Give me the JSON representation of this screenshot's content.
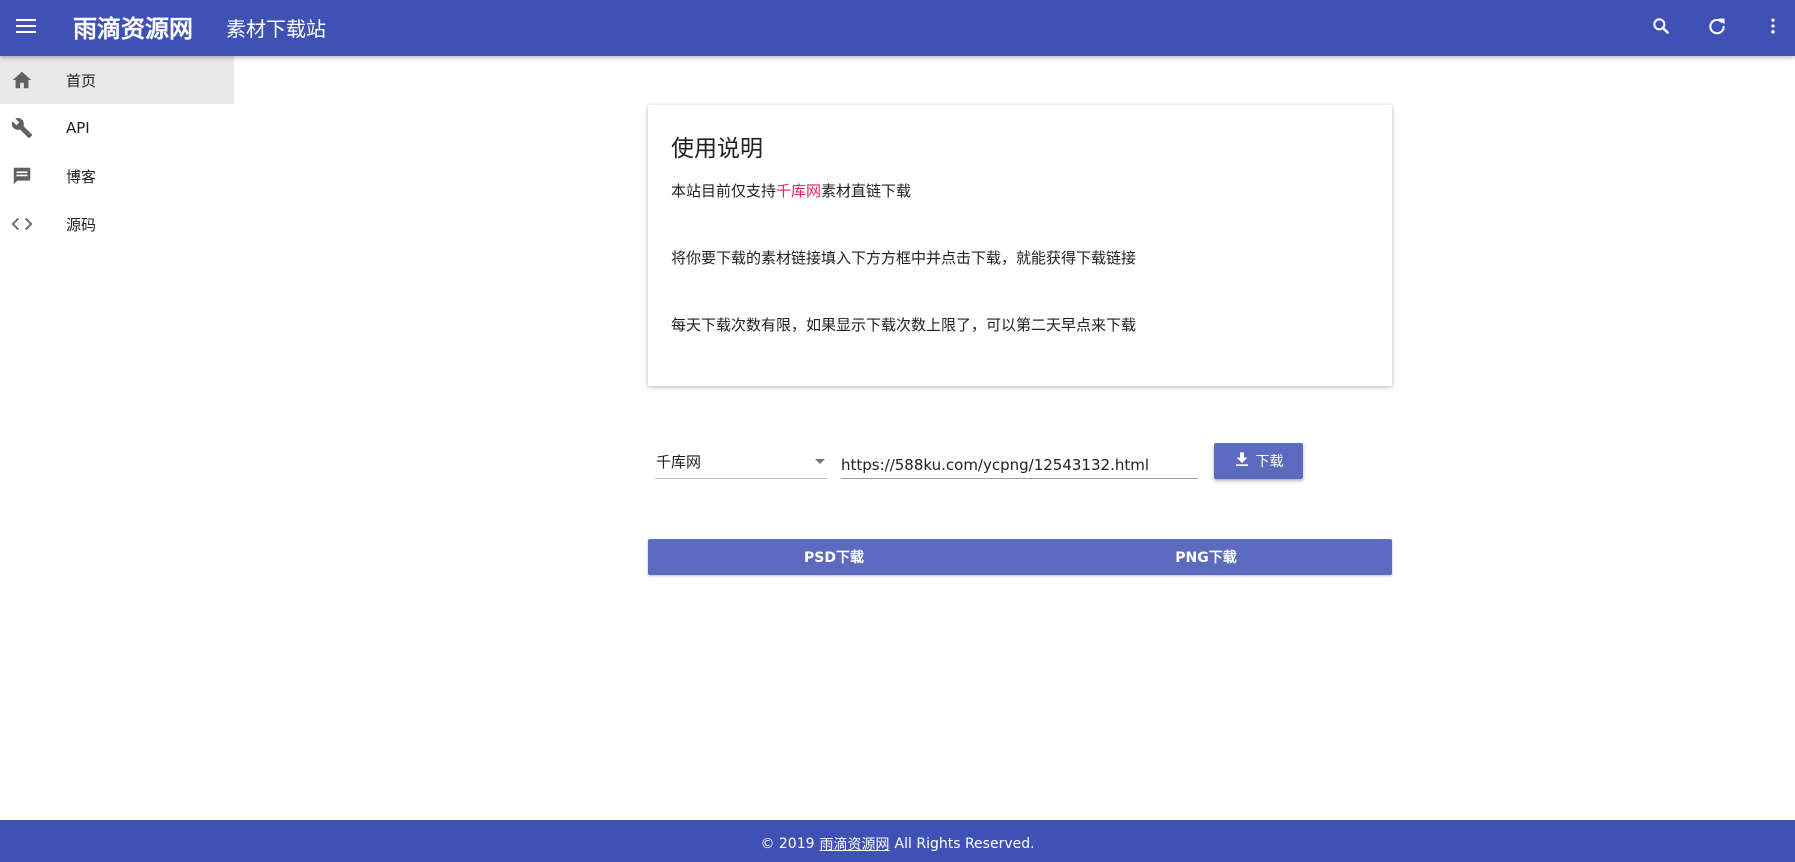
{
  "appbar": {
    "brand": "雨滴资源网",
    "subtitle": "素材下载站",
    "icons": [
      "menu-icon",
      "search-icon",
      "refresh-icon",
      "more-vert-icon"
    ],
    "color": "#3f51b5"
  },
  "sidebar": {
    "items": [
      {
        "label": "首页",
        "icon": "home-icon",
        "active": true
      },
      {
        "label": "API",
        "icon": "wrench-icon",
        "active": false
      },
      {
        "label": "博客",
        "icon": "comment-icon",
        "active": false
      },
      {
        "label": "源码",
        "icon": "code-icon",
        "active": false
      }
    ]
  },
  "card": {
    "title": "使用说明",
    "line1_before": "本站目前仅支持",
    "line1_highlight": "千库网",
    "line1_after": "素材直链下载",
    "line2": "将你要下载的素材链接填入下方方框中并点击下载，就能获得下载链接",
    "line3": "每天下载次数有限，如果显示下载次数上限了，可以第二天早点来下载",
    "highlight_color": "#e91e63"
  },
  "form": {
    "site_select": "千库网",
    "url_value": "https://588ku.com/ycpng/12543132.html",
    "download_label": "下载",
    "button_color": "#5c6bc0"
  },
  "results": {
    "psd_label": "PSD下载",
    "png_label": "PNG下载"
  },
  "footer": {
    "prefix": "© 2019",
    "link": "雨滴资源网",
    "suffix": "All Rights Reserved."
  }
}
